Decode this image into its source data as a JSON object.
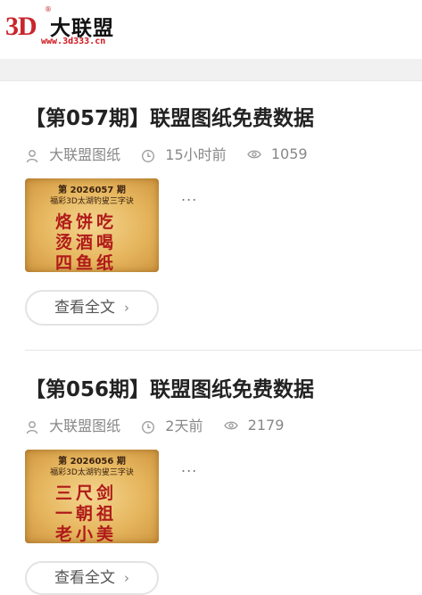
{
  "header": {
    "logo_mark": "3D",
    "logo_registered": "®",
    "logo_name": "大联盟",
    "logo_url": "www.3d333.cn"
  },
  "posts": [
    {
      "title": "【第057期】联盟图纸免费数据",
      "author": "大联盟图纸",
      "time": "15小时前",
      "views": "1059",
      "thumb_issue": "第 2026057 期",
      "thumb_subtitle": "福彩3D太湖钓叟三字诀",
      "thumb_lines": [
        "烙饼吃",
        "烫酒喝",
        "四鱼纸"
      ],
      "excerpt": "...",
      "read_more": "查看全文"
    },
    {
      "title": "【第056期】联盟图纸免费数据",
      "author": "大联盟图纸",
      "time": "2天前",
      "views": "2179",
      "thumb_issue": "第 2026056 期",
      "thumb_subtitle": "福彩3D太湖钓叟三字诀",
      "thumb_lines": [
        "三尺剑",
        "一朝祖",
        "老小美"
      ],
      "excerpt": "...",
      "read_more": "查看全文"
    }
  ],
  "colors": {
    "brand_red": "#c8262c",
    "text_gray": "#888888",
    "band_gray": "#f1f1f1"
  }
}
